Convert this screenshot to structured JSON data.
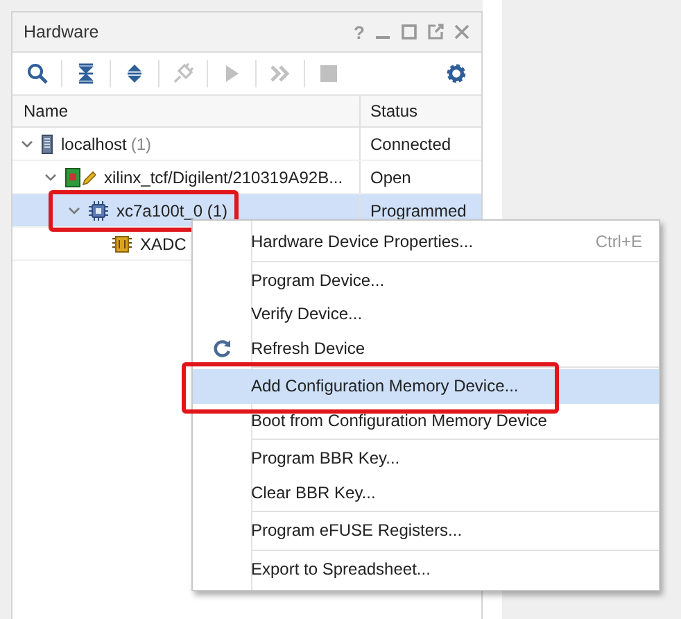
{
  "panel": {
    "title": "Hardware",
    "help": "?"
  },
  "toolbar": [
    {
      "kind": "search",
      "disabled": false
    },
    {
      "kind": "collapse",
      "disabled": false
    },
    {
      "kind": "expand",
      "disabled": false
    },
    {
      "kind": "plug",
      "disabled": true
    },
    {
      "kind": "play",
      "disabled": true
    },
    {
      "kind": "forward",
      "disabled": true
    },
    {
      "kind": "stop",
      "disabled": true
    },
    {
      "kind": "gear",
      "disabled": false
    }
  ],
  "table": {
    "columns": [
      "Name",
      "Status"
    ],
    "rows": [
      {
        "name": "localhost",
        "count": "(1)",
        "status": "Connected",
        "kind": "host",
        "expanded": true,
        "selected": false,
        "annotated": false,
        "children": [
          {
            "name": "xilinx_tcf/Digilent/210319A92B...",
            "status": "Open",
            "kind": "board",
            "expanded": true,
            "selected": false,
            "annotated": false,
            "children": [
              {
                "name": "xc7a100t_0 (1)",
                "status": "Programmed",
                "kind": "device",
                "expanded": true,
                "selected": true,
                "annotated": true,
                "children": [
                  {
                    "name": "XADC",
                    "kind": "monitor",
                    "selected": false,
                    "annotated": false
                  }
                ]
              }
            ]
          }
        ]
      }
    ]
  },
  "context_menu": {
    "groups": [
      [
        {
          "label": "Hardware Device Properties...",
          "shortcut": "Ctrl+E",
          "kind": "plain",
          "selected": false,
          "annotated": false
        }
      ],
      [
        {
          "label": "Program Device...",
          "kind": "plain",
          "selected": false,
          "annotated": false
        },
        {
          "label": "Verify Device...",
          "kind": "plain",
          "selected": false,
          "annotated": false
        },
        {
          "label": "Refresh Device",
          "kind": "refresh",
          "selected": false,
          "annotated": false
        }
      ],
      [
        {
          "label": "Add Configuration Memory Device...",
          "kind": "plain",
          "selected": true,
          "annotated": true
        },
        {
          "label": "Boot from Configuration Memory Device",
          "kind": "plain",
          "selected": false,
          "annotated": false
        }
      ],
      [
        {
          "label": "Program BBR Key...",
          "kind": "plain",
          "selected": false,
          "annotated": false
        },
        {
          "label": "Clear BBR Key...",
          "kind": "plain",
          "selected": false,
          "annotated": false
        }
      ],
      [
        {
          "label": "Program eFUSE Registers...",
          "kind": "plain",
          "selected": false,
          "annotated": false
        }
      ],
      [
        {
          "label": "Export to Spreadsheet...",
          "kind": "plain",
          "selected": false,
          "annotated": false
        }
      ]
    ]
  }
}
